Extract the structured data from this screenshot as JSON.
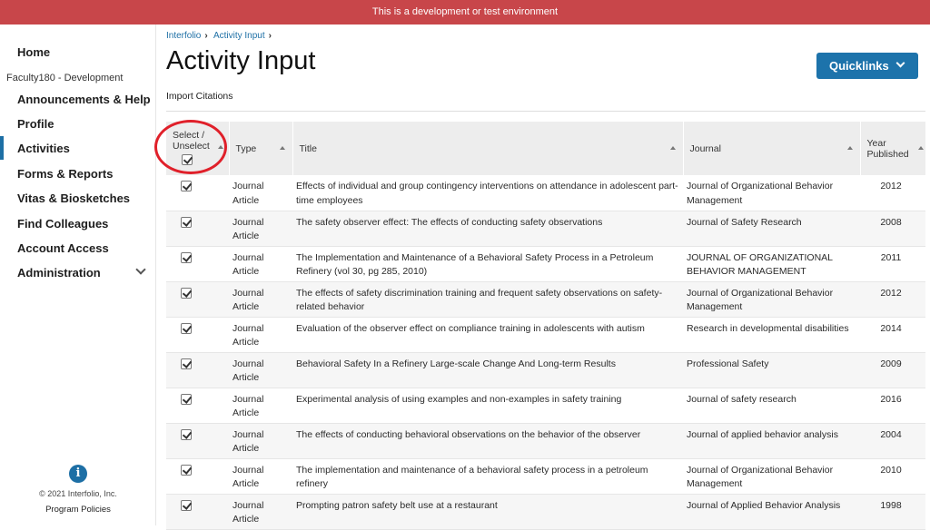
{
  "banner": "This is a development or test environment",
  "sidebar": {
    "home": "Home",
    "org": "Faculty180 - Development",
    "items": [
      "Announcements & Help",
      "Profile",
      "Activities",
      "Forms & Reports",
      "Vitas & Biosketches",
      "Find Colleagues",
      "Account Access",
      "Administration"
    ],
    "active": "Activities",
    "copyright": "© 2021 Interfolio, Inc.",
    "policies": "Program Policies"
  },
  "breadcrumb": [
    "Interfolio",
    "Activity Input"
  ],
  "title": "Activity Input",
  "quicklinks": "Quicklinks",
  "subtitle": "Import Citations",
  "table": {
    "headers": {
      "select_line1": "Select /",
      "select_line2": "Unselect",
      "type": "Type",
      "title": "Title",
      "journal": "Journal",
      "year_line1": "Year",
      "year_line2": "Published"
    },
    "rows": [
      {
        "type": "Journal Article",
        "title": "Effects of individual and group contingency interventions on attendance in adolescent part-time employees",
        "journal": "Journal of Organizational Behavior Management",
        "year": "2012"
      },
      {
        "type": "Journal Article",
        "title": "The safety observer effect: The effects of conducting safety observations",
        "journal": "Journal of Safety Research",
        "year": "2008"
      },
      {
        "type": "Journal Article",
        "title": "The Implementation and Maintenance of a Behavioral Safety Process in a Petroleum Refinery (vol 30, pg 285, 2010)",
        "journal": "JOURNAL OF ORGANIZATIONAL BEHAVIOR MANAGEMENT",
        "year": "2011"
      },
      {
        "type": "Journal Article",
        "title": "The effects of safety discrimination training and frequent safety observations on safety-related behavior",
        "journal": "Journal of Organizational Behavior Management",
        "year": "2012"
      },
      {
        "type": "Journal Article",
        "title": "Evaluation of the observer effect on compliance training in adolescents with autism",
        "journal": "Research in developmental disabilities",
        "year": "2014"
      },
      {
        "type": "Journal Article",
        "title": "Behavioral Safety In a Refinery Large-scale Change And Long-term Results",
        "journal": "Professional Safety",
        "year": "2009"
      },
      {
        "type": "Journal Article",
        "title": "Experimental analysis of using examples and non-examples in safety training",
        "journal": "Journal of safety research",
        "year": "2016"
      },
      {
        "type": "Journal Article",
        "title": "The effects of conducting behavioral observations on the behavior of the observer",
        "journal": "Journal of applied behavior analysis",
        "year": "2004"
      },
      {
        "type": "Journal Article",
        "title": "The implementation and maintenance of a behavioral safety process in a petroleum refinery",
        "journal": "Journal of Organizational Behavior Management",
        "year": "2010"
      },
      {
        "type": "Journal Article",
        "title": "Prompting patron safety belt use at a restaurant",
        "journal": "Journal of Applied Behavior Analysis",
        "year": "1998"
      }
    ]
  },
  "colors": {
    "banner": "#c8464a",
    "accent": "#1d73ab",
    "annotation": "#e0202a"
  }
}
